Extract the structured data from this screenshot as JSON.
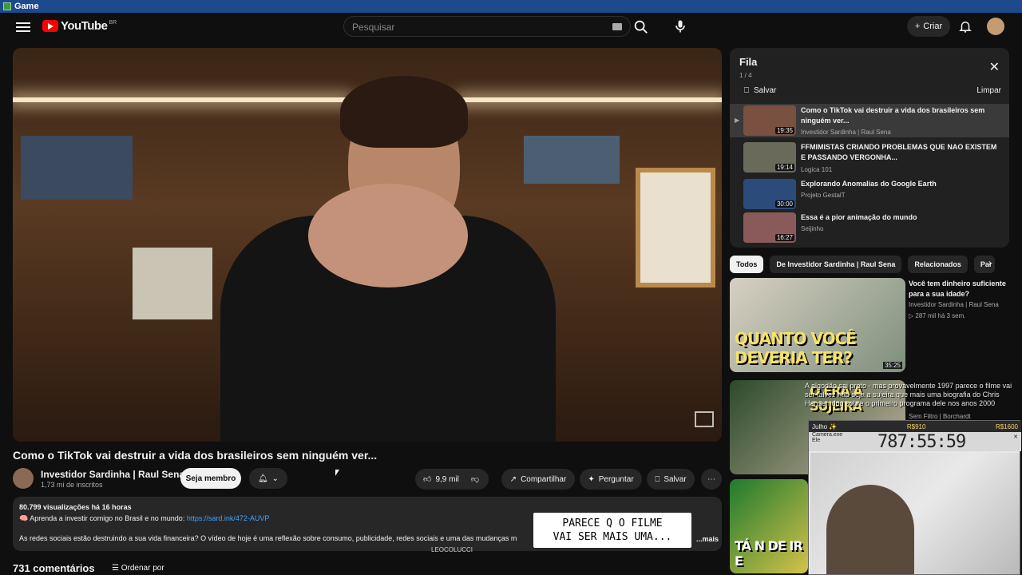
{
  "window": {
    "title": "Game"
  },
  "header": {
    "logo_text": "YouTube",
    "country": "BR",
    "search_placeholder": "Pesquisar",
    "create_label": "Criar"
  },
  "video": {
    "title": "Como o TikTok vai destruir a vida dos brasileiros sem ninguém ver...",
    "channel": "Investidor Sardinha | Raul Sena",
    "subscribers": "1,73 mi de inscritos",
    "member_label": "Seja membro",
    "likes": "9,9 mil",
    "share_label": "Compartilhar",
    "ask_label": "Perguntar",
    "save_label": "Salvar"
  },
  "description": {
    "stats": "80.799 visualizações  há 16 horas",
    "line1_prefix": "🧠 Aprenda a investir comigo no Brasil e no mundo: ",
    "line1_link": "https://sard.ink/472-AUVP",
    "line2": "As redes sociais estão destruindo a sua vida financeira? O vídeo de hoje é uma reflexão sobre consumo, publicidade, redes sociais e uma das mudanças m",
    "more": "...mais"
  },
  "comments": {
    "count_label": "731 comentários",
    "order_label": "Ordenar por"
  },
  "queue": {
    "title": "Fila",
    "position": "1 / 4",
    "save_label": "Salvar",
    "clear_label": "Limpar",
    "items": [
      {
        "title": "Como o TikTok vai destruir a vida dos brasileiros sem ninguém ver...",
        "channel": "Investidor Sardinha | Raul Sena",
        "duration": "19:35"
      },
      {
        "title": "FFMIMISTAS CRIANDO PROBLEMAS QUE NAO EXISTEM E PASSANDO VERGONHA...",
        "channel": "Logica 101",
        "duration": "19:14"
      },
      {
        "title": "Explorando Anomalias do Google Earth",
        "channel": "Projeto GestalT",
        "duration": "30:00"
      },
      {
        "title": "Essa é a pior animação do mundo",
        "channel": "Seijinho",
        "duration": "16:27"
      }
    ]
  },
  "chips": [
    "Todos",
    "De Investidor Sardinha | Raul Sena",
    "Relacionados",
    "Par"
  ],
  "recommendations": [
    {
      "title": "Você tem dinheiro suficiente para a sua idade?",
      "channel": "Investidor Sardinha | Raul Sena",
      "meta": "▷ 287 mil  há 3 sem.",
      "duration": "35:25",
      "thumb_text": "QUANTO VOCÊ DEVERIA TER?"
    },
    {
      "title": "",
      "channel": "Sem Filtro | Borchardt",
      "meta": "",
      "duration": "",
      "thumb_text": "O ERA A SUJEIRA"
    },
    {
      "title": "",
      "channel": "",
      "meta": "",
      "duration": "",
      "thumb_text": "TÁ N DE IR E"
    }
  ],
  "overlay_chat": "A algodão sai preto - mas provavelmente 1997 parece o filme vai ser talvez não seja a sujeira que mais uma biografia do Chris Hansen doq sobre o primeiro programa dele nos anos 2000",
  "timer": {
    "label_left": "Julho ✨",
    "money_mid": "R$910",
    "money_right": "R$1600",
    "value": "787:55:59",
    "camera_label": "Camera.exe",
    "cam_sub": "Ele"
  },
  "subtitle": {
    "line1": "PARECE Q O FILME",
    "line2": "VAI SER MAIS UMA..."
  },
  "stream_tag": "LEOCOLUCCI"
}
